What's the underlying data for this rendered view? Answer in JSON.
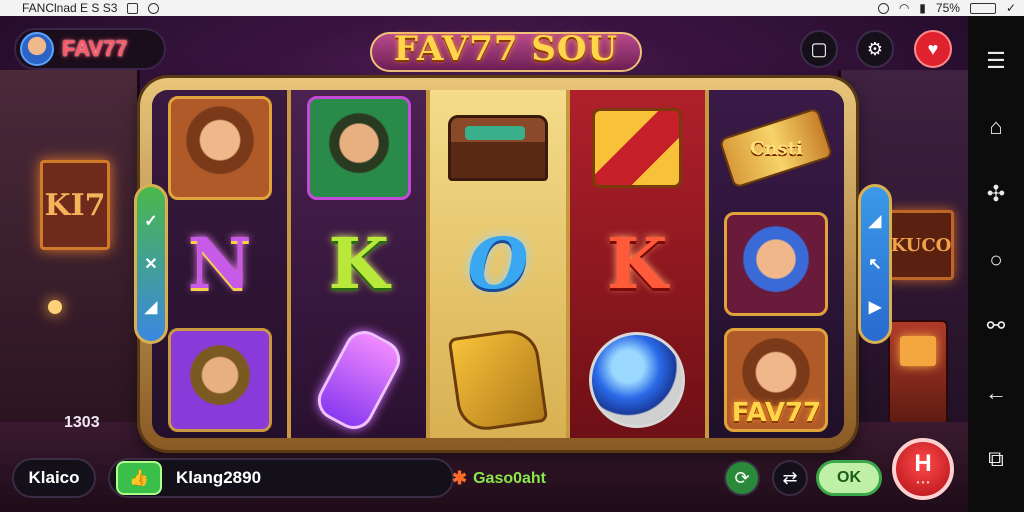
{
  "status_bar": {
    "left_text": "FANClnad E  S  S3",
    "battery": "75%"
  },
  "header": {
    "brand_name": "FAV77",
    "title": "FAV77 SOU"
  },
  "scene": {
    "left_sign": "KI7",
    "right_sign": "KUCO"
  },
  "reels": {
    "scroll_text": "Cnsti",
    "fav_label": "FAV77"
  },
  "paddles": {
    "left_icons": [
      "✓",
      "✕",
      "◢"
    ],
    "right_icons": [
      "◢",
      "↖",
      "▶"
    ]
  },
  "side_value": "1303",
  "bottom": {
    "left_label": "Klaico",
    "bet_label": "Klang2890",
    "status_text": "Gaso0aht",
    "ok_label": "OK",
    "spin_label": "H"
  },
  "colors": {
    "accent": "#e0212e",
    "brand_red": "#ff5a6a",
    "title_gold": "#ffd54a",
    "status_green": "#8ae84a"
  }
}
